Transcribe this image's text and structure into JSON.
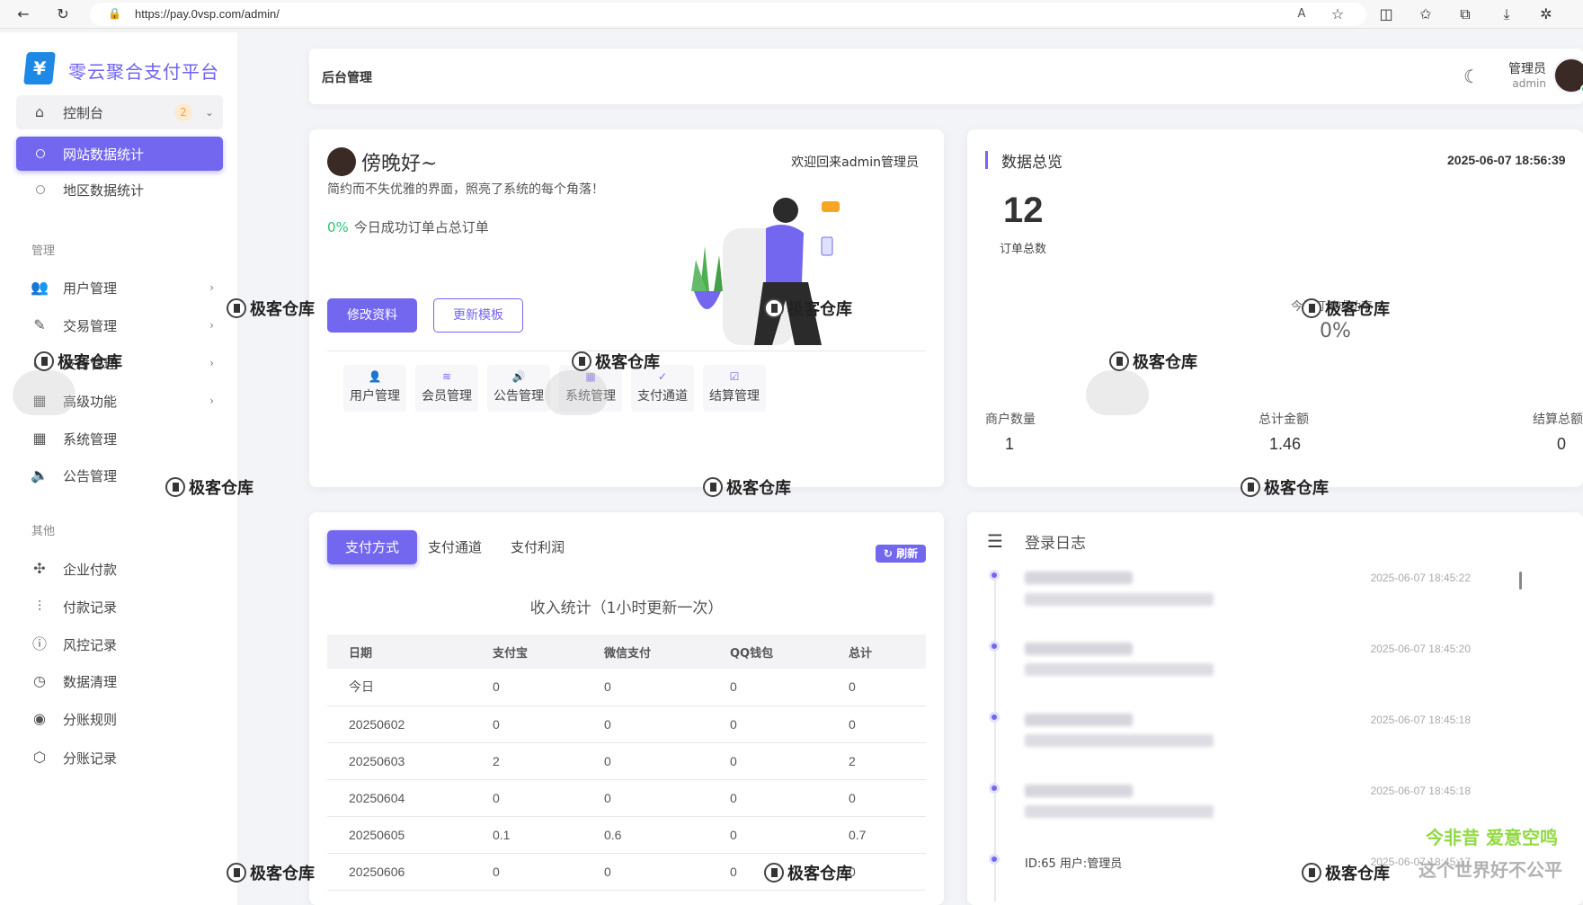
{
  "browser": {
    "url": "https://pay.0vsp.com/admin/"
  },
  "sidebar": {
    "logo_text": "零云聚合支付平台",
    "top_item": {
      "label": "控制台",
      "badge": "2"
    },
    "sub_items": [
      {
        "label": "网站数据统计"
      },
      {
        "label": "地区数据统计"
      }
    ],
    "section_manage": "管理",
    "manage_items": [
      {
        "label": "用户管理"
      },
      {
        "label": "交易管理"
      },
      {
        "label": "支付管理"
      },
      {
        "label": "高级功能"
      },
      {
        "label": "系统管理"
      },
      {
        "label": "公告管理"
      }
    ],
    "section_other": "其他",
    "other_items": [
      {
        "label": "企业付款"
      },
      {
        "label": "付款记录"
      },
      {
        "label": "风控记录"
      },
      {
        "label": "数据清理"
      },
      {
        "label": "分账规则"
      },
      {
        "label": "分账记录"
      }
    ]
  },
  "topbar": {
    "title": "后台管理",
    "user_role": "管理员",
    "user_name": "admin"
  },
  "greeting": {
    "title": "傍晚好~",
    "welcome": "欢迎回来admin管理员",
    "subtitle": "简约而不失优雅的界面，照亮了系统的每个角落！",
    "rate_value": "0%",
    "rate_label": "今日成功订单占总订单",
    "btn_edit_profile": "修改资料",
    "btn_update_template": "更新模板",
    "quick_links": [
      {
        "label": "用户管理",
        "icon": "user-icon"
      },
      {
        "label": "会员管理",
        "icon": "layers-icon"
      },
      {
        "label": "公告管理",
        "icon": "speaker-icon"
      },
      {
        "label": "系统管理",
        "icon": "grid-icon"
      },
      {
        "label": "支付通道",
        "icon": "check-circle-icon"
      },
      {
        "label": "结算管理",
        "icon": "check-square-icon"
      }
    ]
  },
  "overview": {
    "title": "数据总览",
    "datetime": "2025-06-07 18:56:39",
    "total_orders": "12",
    "total_orders_label": "订单总数",
    "today_rate_label": "今日订单成功率",
    "today_rate": "0%",
    "stats": [
      {
        "label": "商户数量",
        "value": "1"
      },
      {
        "label": "总计金额",
        "value": "1.46"
      },
      {
        "label": "结算总额",
        "value": "0"
      }
    ]
  },
  "income": {
    "tabs": [
      "支付方式",
      "支付通道",
      "支付利润"
    ],
    "refresh_label": "刷新",
    "title": "收入统计（1小时更新一次）",
    "columns": [
      "日期",
      "支付宝",
      "微信支付",
      "QQ钱包",
      "总计"
    ],
    "rows": [
      [
        "今日",
        "0",
        "0",
        "0",
        "0"
      ],
      [
        "20250602",
        "0",
        "0",
        "0",
        "0"
      ],
      [
        "20250603",
        "2",
        "0",
        "0",
        "2"
      ],
      [
        "20250604",
        "0",
        "0",
        "0",
        "0"
      ],
      [
        "20250605",
        "0.1",
        "0.6",
        "0",
        "0.7"
      ],
      [
        "20250606",
        "0",
        "0",
        "0",
        "0"
      ]
    ]
  },
  "login_log": {
    "title": "登录日志",
    "entries": [
      {
        "time": "2025-06-07 18:45:22"
      },
      {
        "time": "2025-06-07 18:45:20"
      },
      {
        "time": "2025-06-07 18:45:18"
      },
      {
        "time": "2025-06-07 18:45:18"
      },
      {
        "time": "2025-06-07 18:45:17",
        "text": "ID:65 用户:管理员"
      }
    ]
  },
  "watermarks": {
    "text": "极客仓库",
    "green": "今非昔 爱意空鸣",
    "gray": "这个世界好不公平"
  },
  "colors": {
    "accent": "#7367f0",
    "success": "#28c76f",
    "badge": "#ff9f43"
  }
}
